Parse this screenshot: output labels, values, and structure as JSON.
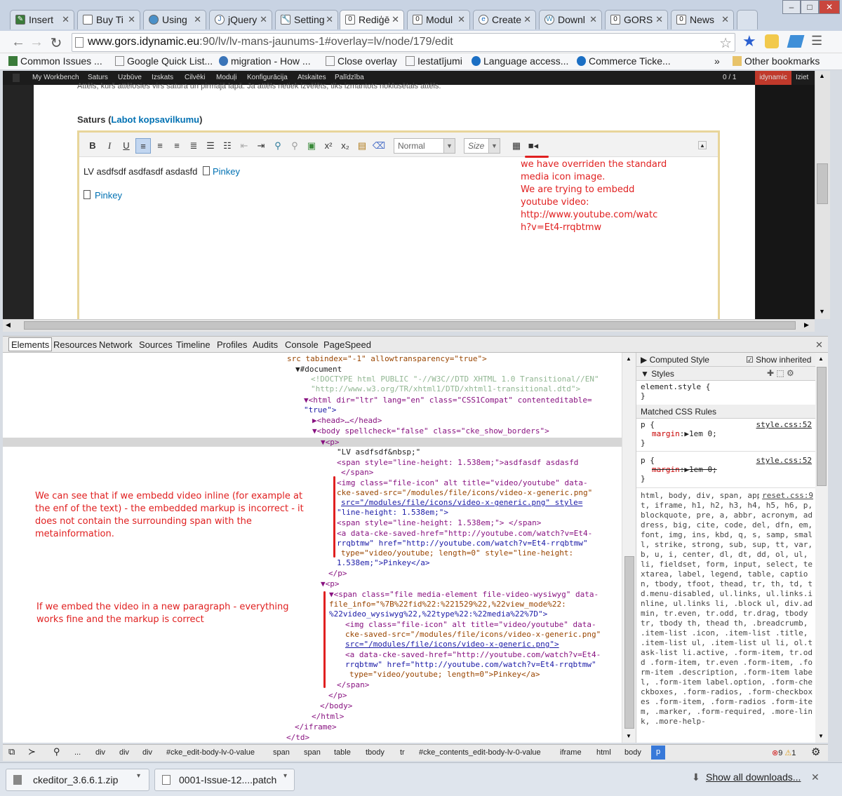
{
  "browser": {
    "tabs": [
      {
        "title": "Insert",
        "icon": "pencil-icon"
      },
      {
        "title": "Buy Ti",
        "icon": "page-icon"
      },
      {
        "title": "Using",
        "icon": "drupal-icon"
      },
      {
        "title": "jQuery",
        "icon": "jquery-icon"
      },
      {
        "title": "Setting",
        "icon": "wrench-icon"
      },
      {
        "title": "Rediģē",
        "icon": "zero-icon"
      },
      {
        "title": "Modul",
        "icon": "zero-icon"
      },
      {
        "title": "Create",
        "icon": "ie-icon"
      },
      {
        "title": "Downl",
        "icon": "wordpress-icon"
      },
      {
        "title": "GORS",
        "icon": "zero-icon"
      },
      {
        "title": "News",
        "icon": "zero-icon"
      }
    ],
    "url": {
      "host": "www.gors.idynamic.eu",
      "rest": ":90/lv/lv-mans-jaunums-1#overlay=lv/node/179/edit"
    },
    "bookmarks": [
      "Common Issues ...",
      "Google Quick List...",
      "migration - How ...",
      "Close overlay",
      "Iestatījumi",
      "Language access...",
      "Commerce Ticke...",
      "Other bookmarks"
    ],
    "bookmarks_more": "»"
  },
  "admin_menu": {
    "items": [
      "My Workbench",
      "Saturs",
      "Uzbūve",
      "Izskats",
      "Cilvēki",
      "Moduļi",
      "Konfigurācija",
      "Atskaites",
      "Palīdzība"
    ],
    "counter": "0 / 1",
    "user": "idynamic",
    "logout": "Iziet"
  },
  "editor": {
    "help_text": "Attēls, kurš attēlosies virs satura un pirmajā lapā. Ja attēls netiek izvēlēts, tiks izmantots noklusētais attēls.",
    "field_label": "Saturs",
    "summary_link": "Labot kopsavilkumu",
    "format": "Normal",
    "size": "Size",
    "line1": "LV asdfsdf asdfasdf asdasfd",
    "link1": "Pinkey",
    "link2": "Pinkey",
    "note": [
      "we have overriden the standard",
      "media icon image.",
      "We are trying to embedd",
      "youtube video:",
      "http://www.youtube.com/watc",
      "h?v=Et4-rrqbtmw"
    ]
  },
  "devtools": {
    "tabs": [
      "Elements",
      "Resources",
      "Network",
      "Sources",
      "Timeline",
      "Profiles",
      "Audits",
      "Console",
      "PageSpeed"
    ],
    "lines": [
      "src tabindex=\"-1\" allowtransparency=\"true\">",
      "#document",
      "<!DOCTYPE html PUBLIC \"-//W3C//DTD XHTML 1.0 Transitional//EN\"",
      "\"http://www.w3.org/TR/xhtml1/DTD/xhtml1-transitional.dtd\">",
      "<html dir=\"ltr\" lang=\"en\" class=\"CSS1Compat\" contenteditable=",
      "\"true\">",
      "<head>…</head>",
      "<body spellcheck=\"false\" class=\"cke_show_borders\">",
      "<p>",
      "\"LV asdfsdf&nbsp;\"",
      "<span style=\"line-height: 1.538em;\">asdfasdf asdasfd",
      "</span>",
      "<img class=\"file-icon\" alt title=\"video/youtube\" data-",
      "cke-saved-src=\"/modules/file/icons/video-x-generic.png\"",
      "src=\"/modules/file/icons/video-x-generic.png\" style=",
      "\"line-height: 1.538em;\">",
      "<span style=\"line-height: 1.538em;\"> </span>",
      "<a data-cke-saved-href=\"http://youtube.com/watch?v=Et4-",
      "rrqbtmw\" href=\"http://youtube.com/watch?v=Et4-rrqbtmw\"",
      "type=\"video/youtube; length=0\" style=\"line-height:",
      "1.538em;\">Pinkey</a>",
      "</p>",
      "<p>",
      "<span class=\"file media-element file-video-wysiwyg\" data-",
      "file_info=\"%7B%22fid%22:%221529%22,%22view_mode%22:",
      "%22video_wysiwyg%22,%22type%22:%22media%22%7D\">",
      "<img class=\"file-icon\" alt title=\"video/youtube\" data-",
      "cke-saved-src=\"/modules/file/icons/video-x-generic.png\"",
      "src=\"/modules/file/icons/video-x-generic.png\">",
      "<a data-cke-saved-href=\"http://youtube.com/watch?v=Et4-",
      "rrqbtmw\" href=\"http://youtube.com/watch?v=Et4-rrqbtmw\"",
      "type=\"video/youtube; length=0\">Pinkey</a>",
      "</span>",
      "</p>",
      "</body>",
      "</html>",
      "</iframe>",
      "</td>"
    ],
    "note1": "We can see that if we embedd video inline (for example at the enf of the text) - the embedded markup is incorrect - it does not contain the surrounding span with the metainformation.",
    "note2": "If we embed the video in a new paragraph - everything works fine and the markup is correct",
    "sidebar": {
      "computed": "Computed Style",
      "show_inherited": "Show inherited",
      "styles": "Styles",
      "element_style": "element.style {",
      "close_brace": "}",
      "matched": "Matched CSS Rules",
      "rule1_selector": "p {",
      "rule1_prop": "margin",
      "rule1_val": "1em 0;",
      "rule1_src": "style.css:52",
      "rule2_selector": "p {",
      "rule2_prop": "margin",
      "rule2_val": "1em 0;",
      "rule2_src": "style.css:52",
      "reset_src": "reset.css:9",
      "reset_selectors": "html, body, div, span, applet, object, iframe, h1, h2, h3, h4, h5, h6, p, blockquote, pre, a, abbr, acronym, address, big, cite, code, del, dfn, em, font, img, ins, kbd, q, s, samp, small, strike, strong, sub, sup, tt, var, b, u, i, center, dl, dt, dd, ol, ul, li, fieldset, form, input, select, textarea, label, legend, table, caption, tbody, tfoot, thead, tr, th, td, td.menu-disabled, ul.links, ul.links.inline, ul.links li, .block ul, div.admin, tr.even, tr.odd, tr.drag, tbody tr, tbody th, thead th, .breadcrumb, .item-list .icon, .item-list .title, .item-list ul, .item-list ul li, ol.task-list li.active, .form-item, tr.odd .form-item, tr.even .form-item, .form-item .description, .form-item label, .form-item label.option, .form-checkboxes, .form-radios, .form-checkboxes .form-item, .form-radios .form-item, .marker, .form-required, .more-link, .more-help-"
    },
    "crumbs": [
      "...",
      "div",
      "div",
      "div",
      "#cke_edit-body-lv-0-value",
      "span",
      "span",
      "table",
      "tbody",
      "tr",
      "#cke_contents_edit-body-lv-0-value",
      "iframe",
      "html",
      "body",
      "p"
    ],
    "errors": "9",
    "warnings": "1"
  },
  "downloads": {
    "items": [
      "ckeditor_3.6.6.1.zip",
      "0001-Issue-12....patch"
    ],
    "show_all": "Show all downloads..."
  }
}
